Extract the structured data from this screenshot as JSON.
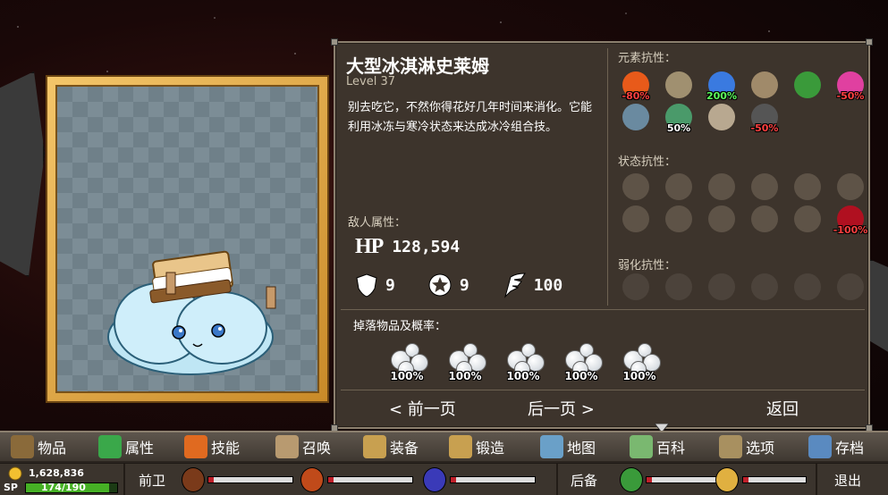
{
  "monster": {
    "name": "大型冰淇淋史莱姆",
    "level": "Level 37",
    "description": "别去吃它，不然你得花好几年时间来消化。它能利用冰冻与寒冷状态来达成冰冷组合技。"
  },
  "stats": {
    "enemy_label": "敌人属性：",
    "hp_label": "HP",
    "hp": "128,594",
    "armor": "9",
    "magic_armor": "9",
    "evasion": "100"
  },
  "resistances": {
    "element_label": "元素抗性：",
    "element": [
      {
        "icon": "fire-icon",
        "value": "-80%",
        "color": "#ff4040"
      },
      {
        "icon": "lightning-icon",
        "value": "",
        "color": "#ffffff"
      },
      {
        "icon": "ice-crystal-icon",
        "value": "200%",
        "color": "#5cff5c"
      },
      {
        "icon": "earth-icon",
        "value": "",
        "color": "#ffffff"
      },
      {
        "icon": "poison-icon",
        "value": "",
        "color": "#ffffff"
      },
      {
        "icon": "arcane-icon",
        "value": "-50%",
        "color": "#ff4040"
      },
      {
        "icon": "water-icon",
        "value": "",
        "color": "#ffffff"
      },
      {
        "icon": "wind-icon",
        "value": "50%",
        "color": "#ffffff"
      },
      {
        "icon": "spiral-icon",
        "value": "",
        "color": "#ffffff"
      },
      {
        "icon": "dark-icon",
        "value": "-50%",
        "color": "#ff4040"
      }
    ],
    "status_label": "状态抗性：",
    "status": [
      {
        "icon": "burn-icon",
        "value": ""
      },
      {
        "icon": "stun-icon",
        "value": ""
      },
      {
        "icon": "freeze-icon",
        "value": ""
      },
      {
        "icon": "poison-status-icon",
        "value": ""
      },
      {
        "icon": "hex-icon",
        "value": ""
      },
      {
        "icon": "curse-icon",
        "value": ""
      },
      {
        "icon": "confuse-icon",
        "value": ""
      },
      {
        "icon": "fear-icon",
        "value": ""
      },
      {
        "icon": "weaken-icon",
        "value": ""
      },
      {
        "icon": "sleep-icon",
        "value": ""
      },
      {
        "icon": "silence-icon",
        "value": ""
      },
      {
        "icon": "doom-icon",
        "value": "-100%",
        "color": "#ff4040"
      }
    ],
    "debuff_label": "弱化抗性："
  },
  "drops": {
    "label": "掉落物品及概率：",
    "items": [
      {
        "icon": "snowball-icon",
        "chance": "100%"
      },
      {
        "icon": "snowball-icon",
        "chance": "100%"
      },
      {
        "icon": "snowball-icon",
        "chance": "100%"
      },
      {
        "icon": "snowball-icon",
        "chance": "100%"
      },
      {
        "icon": "snowball-icon",
        "chance": "100%"
      }
    ]
  },
  "nav": {
    "prev": "< 前一页",
    "next": "后一页 >",
    "back": "返回"
  },
  "menu": [
    {
      "label": "物品",
      "icon": "bag-icon",
      "color": "#8a6a3a"
    },
    {
      "label": "属性",
      "icon": "gem-icon",
      "color": "#3aa84a"
    },
    {
      "label": "技能",
      "icon": "flame-icon",
      "color": "#e06a20"
    },
    {
      "label": "召唤",
      "icon": "summon-icon",
      "color": "#b89a70"
    },
    {
      "label": "装备",
      "icon": "boot-icon",
      "color": "#c8a050"
    },
    {
      "label": "锻造",
      "icon": "anvil-icon",
      "color": "#c8a050"
    },
    {
      "label": "地图",
      "icon": "map-icon",
      "color": "#6aa0c8"
    },
    {
      "label": "百科",
      "icon": "gameboy-icon",
      "color": "#7ab870"
    },
    {
      "label": "选项",
      "icon": "gear-icon",
      "color": "#a89060"
    },
    {
      "label": "存档",
      "icon": "floppy-icon",
      "color": "#5a8ac0"
    }
  ],
  "status": {
    "gold": "1,628,836",
    "sp_label": "SP",
    "sp": "174/190",
    "sp_fraction": 0.916,
    "front_label": "前卫",
    "back_label": "后备",
    "exit_label": "退出"
  }
}
